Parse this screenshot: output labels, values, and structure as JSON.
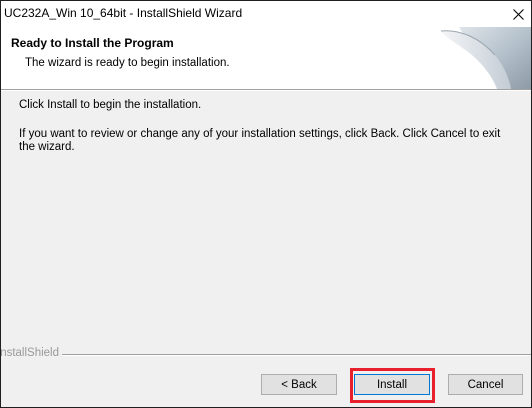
{
  "window": {
    "title": "UC232A_Win 10_64bit - InstallShield Wizard",
    "close_glyph": "✕"
  },
  "header": {
    "title": "Ready to Install the Program",
    "subtitle": "The wizard is ready to begin installation.",
    "graphic_icon": "wizard-page-curl-icon"
  },
  "body": {
    "line1": "Click Install to begin the installation.",
    "line2": "If you want to review or change any of your installation settings, click Back. Click Cancel to exit the wizard."
  },
  "footer": {
    "brand": "InstallShield"
  },
  "buttons": {
    "back": "< Back",
    "install": "Install",
    "cancel": "Cancel"
  },
  "annotation": {
    "highlight_color": "#e8202e",
    "highlight_target": "install-button"
  }
}
